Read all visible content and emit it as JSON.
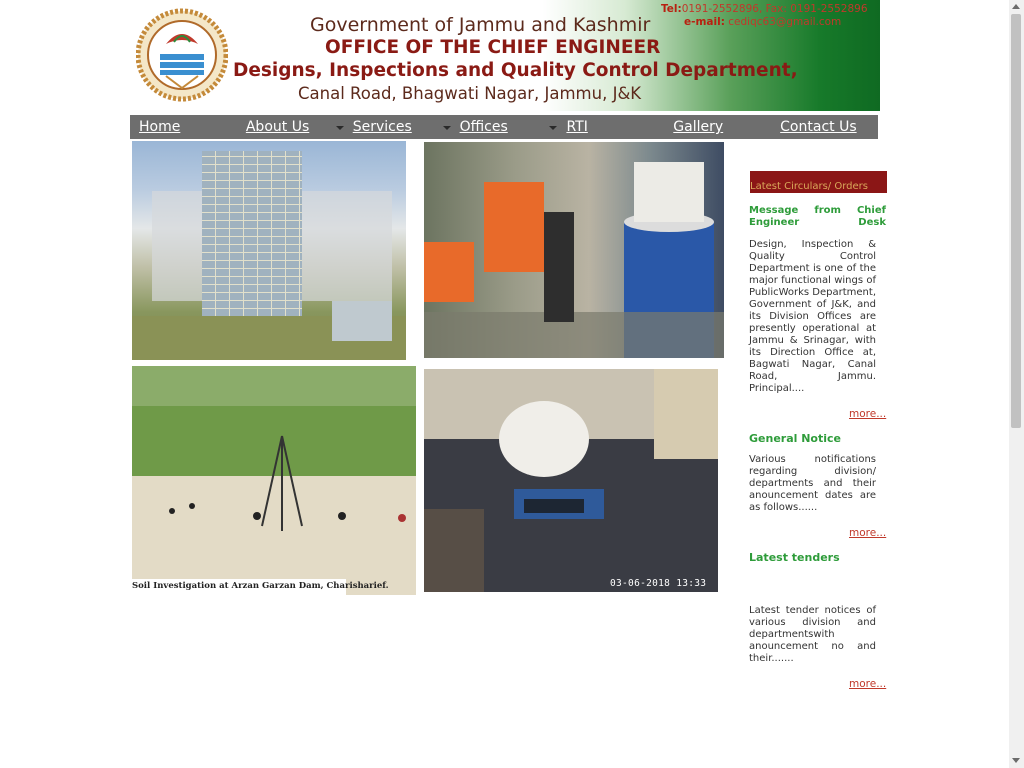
{
  "header": {
    "line1": "Government of Jammu and Kashmir",
    "line2": "OFFICE OF THE CHIEF ENGINEER",
    "line3": "Designs, Inspections and Quality Control Department,",
    "line4": "Canal Road, Bhagwati Nagar, Jammu, J&K",
    "tel_label": "Tel:",
    "tel_value": "0191-2552896, Fax: 0191-2552896",
    "email_label": "e-mail:",
    "email_value": "cediqc63@gmail.com",
    "emblem_icon": "jk-government-emblem-icon"
  },
  "nav": {
    "items": [
      {
        "label": "Home",
        "dropdown": false
      },
      {
        "label": "About Us",
        "dropdown": true
      },
      {
        "label": "Services",
        "dropdown": true
      },
      {
        "label": "Offices",
        "dropdown": true
      },
      {
        "label": "RTI",
        "dropdown": false
      },
      {
        "label": "Gallery",
        "dropdown": false
      },
      {
        "label": "Contact Us",
        "dropdown": false
      }
    ]
  },
  "gallery": {
    "caption": "Soil Investigation at Arzan Garzan Dam, Charisharief.",
    "timestamp": "03-06-2018 13:33"
  },
  "sidebar": {
    "circulars_heading": "Latest Circulars/ Orders",
    "message_title": "Message from Chief Engineer Desk",
    "message_text": "Design, Inspection & Quality Control Department is one of the major functional wings of PublicWorks Department, Government of J&K, and its Division Offices are presently operational at Jammu & Srinagar, with its Direction Office at, Bagwati Nagar, Canal Road, Jammu. Principal....",
    "more_label": "more...",
    "notice_title": "General Notice",
    "notice_text": "Various notifications regarding division/ departments and their anouncement dates are as follows......",
    "tenders_title": "Latest tenders",
    "tenders_text": "Latest tender notices of various division and departmentswith anouncement no and their......."
  },
  "colors": {
    "nav_bg": "#6e6e6e",
    "accent_green": "#2e9c3a",
    "link_red": "#c0392b",
    "heading_bar": "#8b1616"
  }
}
